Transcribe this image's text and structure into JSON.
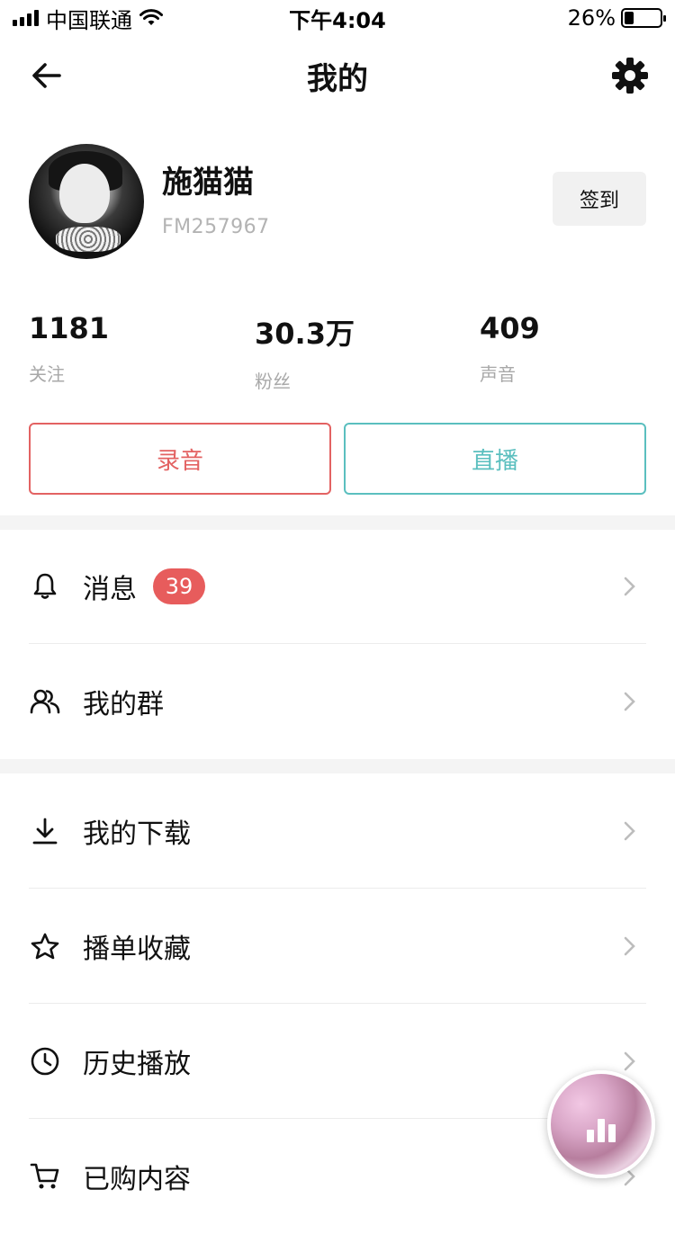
{
  "status_bar": {
    "carrier": "中国联通",
    "time": "下午4:04",
    "battery_percent": "26%",
    "battery_level": 0.26
  },
  "nav": {
    "title": "我的",
    "back_icon": "arrow-left-icon",
    "settings_icon": "gear-icon"
  },
  "profile": {
    "name": "施猫猫",
    "id": "FM257967",
    "checkin_label": "签到"
  },
  "stats": [
    {
      "value": "1181",
      "label": "关注"
    },
    {
      "value": "30.3万",
      "label": "粉丝"
    },
    {
      "value": "409",
      "label": "声音"
    }
  ],
  "actions": {
    "record_label": "录音",
    "live_label": "直播",
    "record_color": "#e36262",
    "live_color": "#5bbfbf"
  },
  "menu_group_1": [
    {
      "label": "消息",
      "icon": "bell-icon",
      "badge": "39"
    },
    {
      "label": "我的群",
      "icon": "group-icon"
    }
  ],
  "menu_group_2": [
    {
      "label": "我的下载",
      "icon": "download-icon"
    },
    {
      "label": "播单收藏",
      "icon": "star-icon"
    },
    {
      "label": "历史播放",
      "icon": "clock-icon"
    },
    {
      "label": "已购内容",
      "icon": "cart-icon"
    }
  ],
  "colors": {
    "badge": "#e75c5c",
    "divider": "#ececec",
    "section_gap": "#f4f4f4"
  }
}
